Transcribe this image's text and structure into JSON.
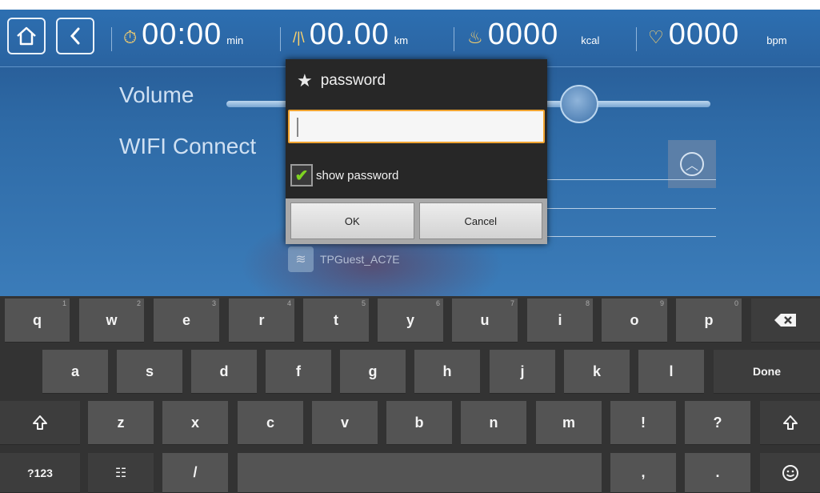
{
  "topbar": {
    "time": {
      "value": "00:00",
      "unit": "min",
      "icon": "timer-icon"
    },
    "distance": {
      "value": "00.00",
      "unit": "km",
      "icon": "road-icon"
    },
    "calories": {
      "value": "0000",
      "unit": "kcal",
      "icon": "flame-icon"
    },
    "heart_rate": {
      "value": "0000",
      "unit": "bpm",
      "icon": "heart-rate-icon"
    }
  },
  "settings": {
    "volume_label": "Volume",
    "volume_level": 0.72,
    "wifi_label": "WIFI Connect",
    "network_name": "TPGuest_AC7E"
  },
  "dialog": {
    "title": "password",
    "password_value": "",
    "show_password_label": "show password",
    "show_password_checked": true,
    "ok_label": "OK",
    "cancel_label": "Cancel"
  },
  "keyboard": {
    "row1": [
      {
        "label": "q",
        "hint": "1"
      },
      {
        "label": "w",
        "hint": "2"
      },
      {
        "label": "e",
        "hint": "3"
      },
      {
        "label": "r",
        "hint": "4"
      },
      {
        "label": "t",
        "hint": "5"
      },
      {
        "label": "y",
        "hint": "6"
      },
      {
        "label": "u",
        "hint": "7"
      },
      {
        "label": "i",
        "hint": "8"
      },
      {
        "label": "o",
        "hint": "9"
      },
      {
        "label": "p",
        "hint": "0"
      }
    ],
    "row2": [
      "a",
      "s",
      "d",
      "f",
      "g",
      "h",
      "j",
      "k",
      "l"
    ],
    "row3": [
      "z",
      "x",
      "c",
      "v",
      "b",
      "n",
      "m",
      "!",
      "?"
    ],
    "done_label": "Done",
    "symbols_label": "?123",
    "slash_label": "/",
    "comma_label": ",",
    "period_label": ".",
    "backspace_icon": "backspace-icon",
    "shift_icon": "shift-icon",
    "settings_icon": "keyboard-settings-icon",
    "emoji_icon": "emoji-icon"
  },
  "colors": {
    "accent_orange": "#f0a431",
    "check_green": "#7ed321",
    "app_blue": "#2e6aa6"
  }
}
